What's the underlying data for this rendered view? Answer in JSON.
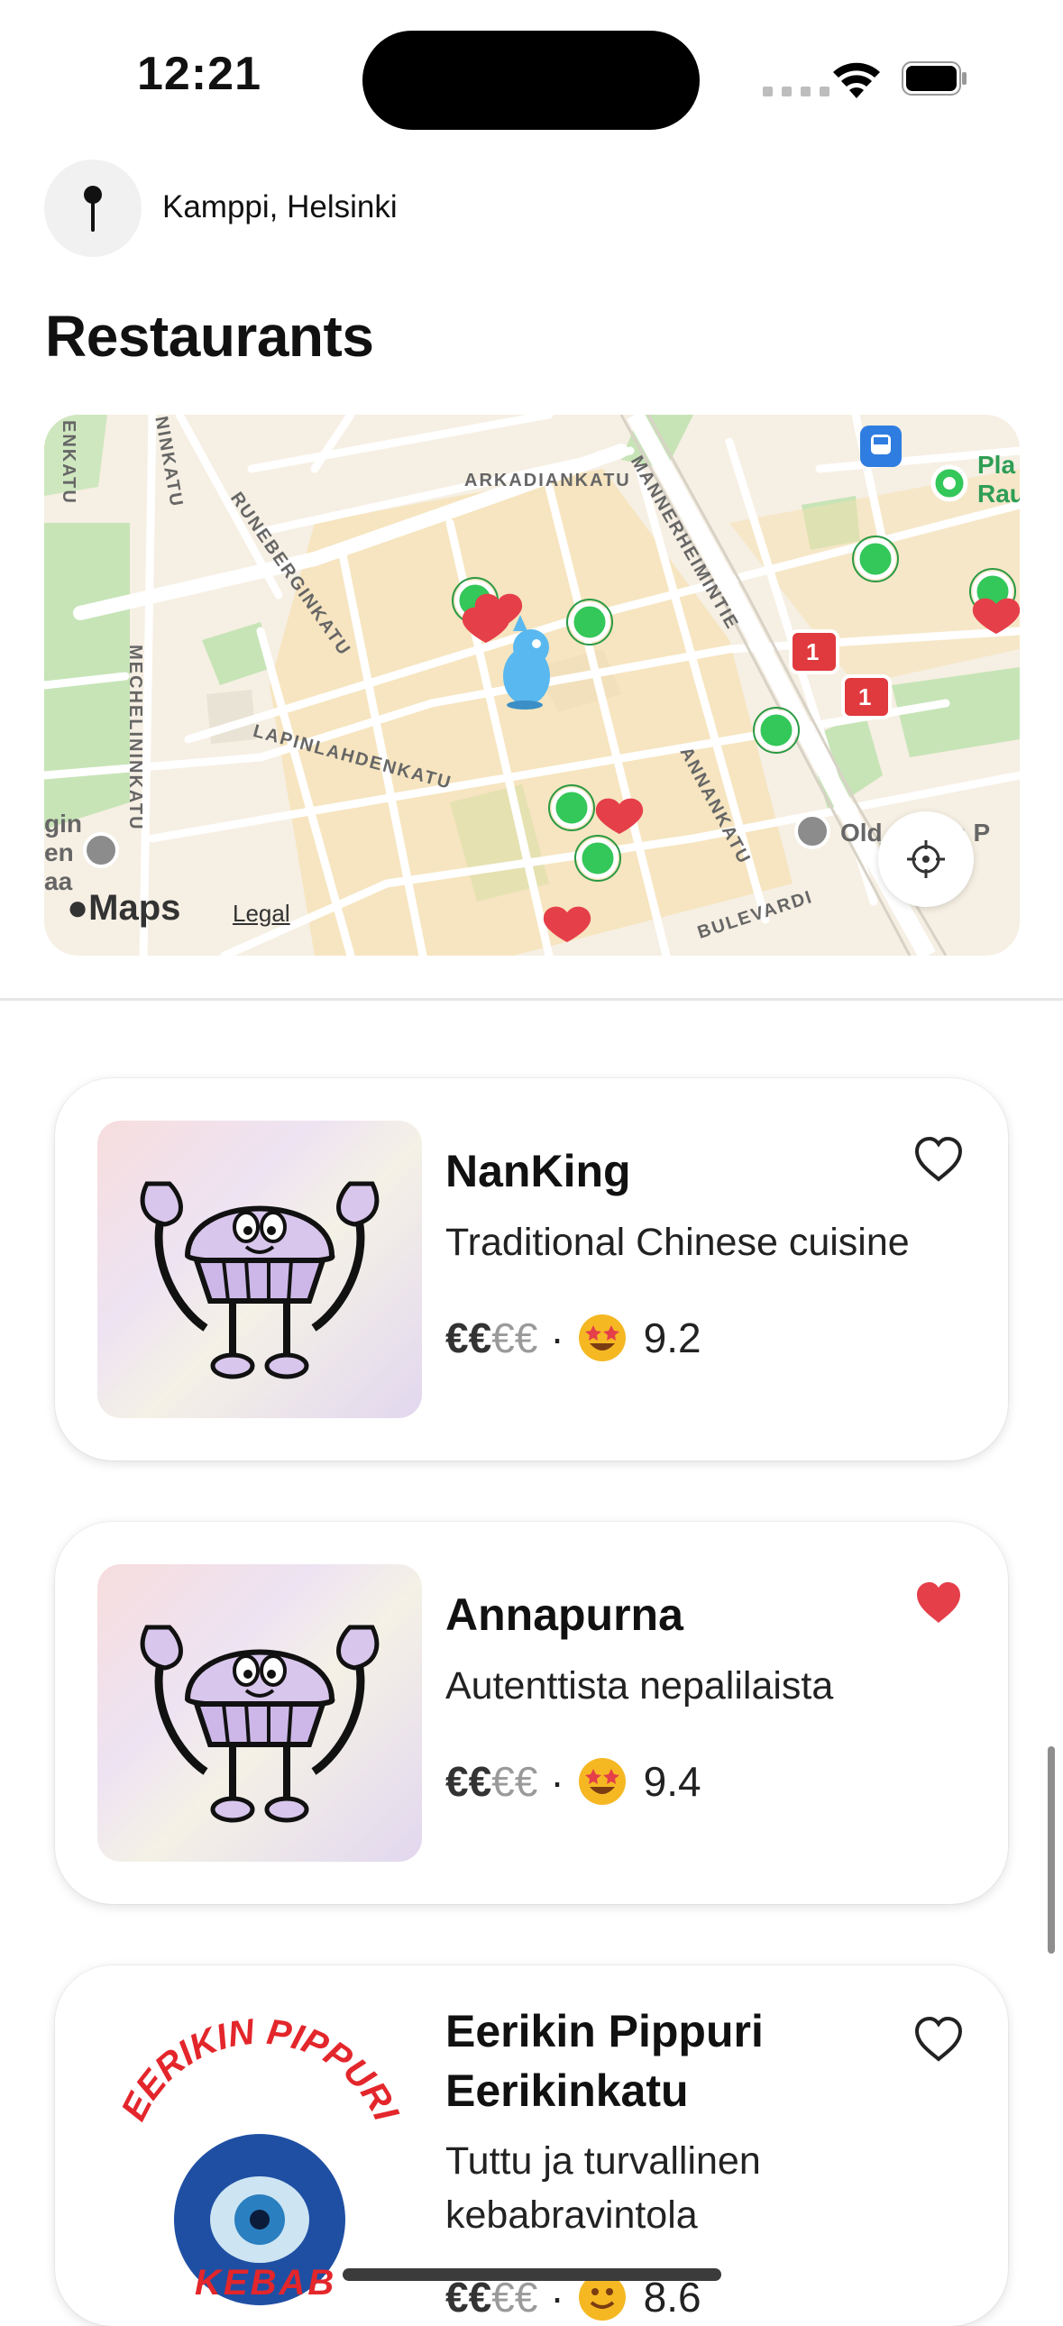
{
  "status_bar": {
    "time": "12:21",
    "wifi_icon": "wifi-icon",
    "battery_icon": "battery-icon"
  },
  "location": {
    "label": "Kamppi, Helsinki",
    "icon": "map-pin-icon"
  },
  "title": "Restaurants",
  "map": {
    "streets": [
      "ARKADIANKATU",
      "RUNEBERGINKATU",
      "MANNERHEIMINTIE",
      "LAPINLAHDENKATU",
      "ANNANKATU",
      "MECHELININKATU",
      "BULEVARDI",
      "ENKATU",
      "NINKATU"
    ],
    "poi_labels": [
      "Pla",
      "Rau",
      "Old",
      "ch P",
      "gin",
      "en",
      "aa"
    ],
    "badges": [
      "1",
      "1"
    ],
    "maps_brand": "Maps",
    "legal": "Legal",
    "colors": {
      "restaurant_marker": "#34c759",
      "favorite_marker": "#e53f4a",
      "badge": "#e0393e"
    }
  },
  "restaurants": [
    {
      "name": "NanKing",
      "name2": "",
      "description": "Traditional Chinese cuisine",
      "desc2": "",
      "price_on": "€€",
      "price_off": "€€",
      "separator": "·",
      "rating": "9.2",
      "favorite": false
    },
    {
      "name": "Annapurna",
      "name2": "",
      "description": "Autenttista nepalilaista",
      "desc2": "",
      "price_on": "€€",
      "price_off": "€€",
      "separator": "·",
      "rating": "9.4",
      "favorite": true
    },
    {
      "name": "Eerikin Pippuri",
      "name2": "Eerikinkatu",
      "description": "Tuttu ja turvallinen",
      "desc2": "kebabravintola",
      "price_on": "€€",
      "price_off": "€€",
      "separator": "·",
      "rating": "8.6",
      "favorite": false,
      "logo_text_top": "EERIKIN PIPPURI",
      "logo_text_bottom": "KEBAB"
    }
  ]
}
